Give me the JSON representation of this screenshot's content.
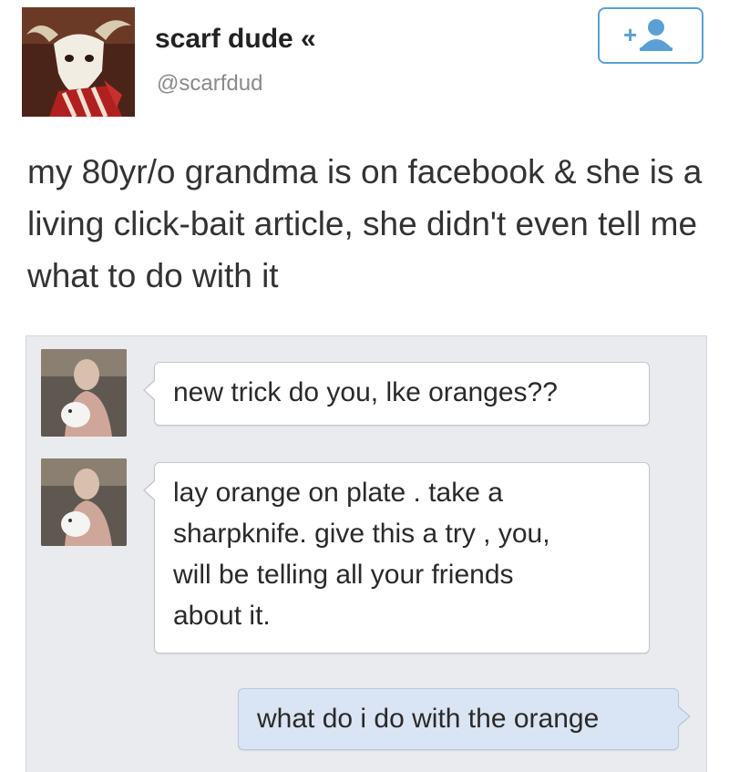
{
  "tweet": {
    "display_name": "scarf dude «",
    "handle": "@scarfdud",
    "text": "my 80yr/o grandma is on facebook & she is a living click-bait article, she didn't even tell me what to do with it",
    "follow_icon": "add-user-icon"
  },
  "chat": {
    "messages": [
      {
        "side": "left",
        "text": "new trick do you, lke oranges??"
      },
      {
        "side": "left",
        "text": "lay orange on plate . take a\nsharpknife. give this a try , you,\nwill be telling all your friends\nabout it."
      },
      {
        "side": "right",
        "text": "what do i do with the orange"
      }
    ]
  },
  "colors": {
    "follow_button": "#5a9fd6",
    "chat_background": "#e9ebef",
    "reply_bubble": "#d9e4f4"
  }
}
